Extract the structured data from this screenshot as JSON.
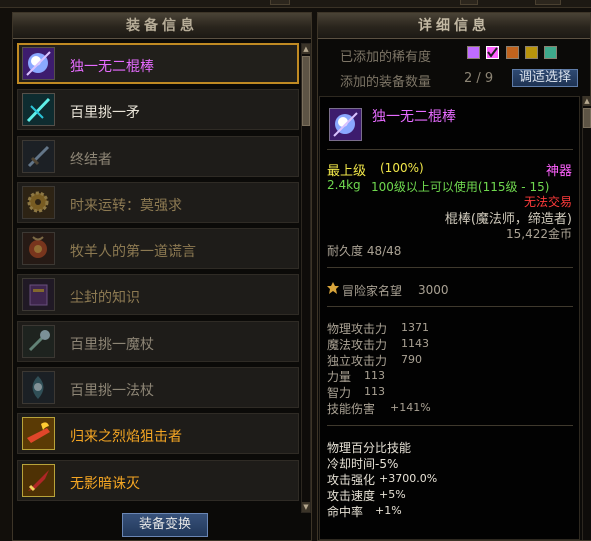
{
  "colors": {
    "panel_bg": "#0b0a08",
    "header_text": "#b7ad98",
    "selected_border": "#c08a23",
    "epic_pink": "#e66bff",
    "legendary_orange": "#f5a623",
    "unique_yellow": "#f2e84a",
    "dim_text": "#7d7566",
    "green_text": "#6fd84f",
    "red_text": "#ff3b3b",
    "button_blue": "#22385a"
  },
  "left": {
    "title": "装备信息",
    "items": [
      {
        "label": "独一无二棍棒",
        "color": "#e66bff",
        "icon": "staff-orb-icon",
        "selected": true,
        "dim": false
      },
      {
        "label": "百里挑一矛",
        "color": "#e7e2d6",
        "icon": "spear-icon",
        "selected": false,
        "dim": false
      },
      {
        "label": "终结者",
        "color": "#8d8575",
        "icon": "sword-icon",
        "selected": false,
        "dim": true
      },
      {
        "label": "时来运转：莫强求",
        "color": "#8d7a52",
        "icon": "gear-icon",
        "selected": false,
        "dim": true
      },
      {
        "label": "牧羊人的第一道谎言",
        "color": "#8d7a52",
        "icon": "amulet-icon",
        "selected": false,
        "dim": true
      },
      {
        "label": "尘封的知识",
        "color": "#8d7a52",
        "icon": "book-icon",
        "selected": false,
        "dim": true
      },
      {
        "label": "百里挑一魔杖",
        "color": "#8d8575",
        "icon": "wand-icon",
        "selected": false,
        "dim": true
      },
      {
        "label": "百里挑一法杖",
        "color": "#8d8575",
        "icon": "rod-icon",
        "selected": false,
        "dim": true
      },
      {
        "label": "归来之烈焰狙击者",
        "color": "#f5a623",
        "icon": "flame-gun-icon",
        "selected": false,
        "dim": false
      },
      {
        "label": "无影暗诛灭",
        "color": "#f5a623",
        "icon": "dark-blade-icon",
        "selected": false,
        "dim": false
      }
    ],
    "button_label": "装备变换"
  },
  "right": {
    "title": "详细信息",
    "rarity_label": "已添加的稀有度",
    "count_label": "添加的装备数量",
    "count_value": "2 / 9",
    "select_label": "调适选择",
    "rarity_swatches": [
      {
        "color": "#c06cff",
        "checked": false
      },
      {
        "color": "#ff62ff",
        "checked": true
      },
      {
        "color": "#c0631e",
        "checked": false
      },
      {
        "color": "#b8940c",
        "checked": false
      },
      {
        "color": "#3ea98b",
        "checked": false
      }
    ],
    "detail": {
      "name": "独一无二棍棒",
      "grade": "最上级",
      "grade_pct": "(100%)",
      "rarity": "神器",
      "weight": "2.4kg",
      "requirement": "100级以上可以使用(115级 - 15)",
      "untradeable": "无法交易",
      "type": "棍棒(魔法师，缔造者)",
      "price": "15,422金币",
      "durability": "耐久度 48/48",
      "fame_label": "冒险家名望",
      "fame_value": "3000",
      "stats": [
        {
          "label": "物理攻击力",
          "value": "1371"
        },
        {
          "label": "魔法攻击力",
          "value": "1143"
        },
        {
          "label": "独立攻击力",
          "value": "790"
        },
        {
          "label": "力量",
          "value": "113"
        },
        {
          "label": "智力",
          "value": "113"
        },
        {
          "label": "技能伤害",
          "value": "+141%"
        }
      ],
      "extras": [
        {
          "label": "物理百分比技能",
          "value": ""
        },
        {
          "label": " 冷却时间-5%",
          "value": ""
        },
        {
          "label": "攻击强化",
          "value": "+3700.0%"
        },
        {
          "label": "攻击速度",
          "value": "+5%"
        },
        {
          "label": "命中率",
          "value": "+1%"
        }
      ]
    }
  }
}
